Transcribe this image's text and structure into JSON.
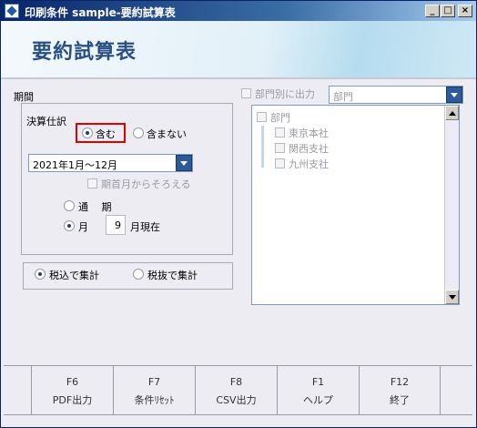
{
  "window": {
    "title": "印刷条件 sample-要約試算表"
  },
  "header": {
    "title": "要約試算表"
  },
  "period": {
    "label": "期間",
    "settlement": {
      "label": "決算仕訳",
      "include": "含む",
      "exclude": "含まない",
      "selected": "include"
    },
    "period_select": {
      "value": "2021年1月～12月"
    },
    "align_checkbox": {
      "label": "期首月からそろえる",
      "checked": false,
      "enabled": false
    },
    "mode": {
      "annual": "通　 期",
      "monthly": "月",
      "month_value": "9",
      "month_suffix": "月現在",
      "selected": "monthly"
    }
  },
  "tax": {
    "include": "税込で集計",
    "exclude": "税抜で集計",
    "selected": "include"
  },
  "department": {
    "by_dept_label": "部門別に出力",
    "by_dept_checked": false,
    "select_value": "部門",
    "tree": {
      "root": "部門",
      "items": [
        "東京本社",
        "関西支社",
        "九州支社"
      ]
    }
  },
  "footer": {
    "keys": [
      {
        "key": "F6",
        "label": "PDF出力"
      },
      {
        "key": "F7",
        "label": "条件ﾘｾｯﾄ"
      },
      {
        "key": "F8",
        "label": "CSV出力"
      },
      {
        "key": "F1",
        "label": "ヘルプ"
      },
      {
        "key": "F12",
        "label": "終了"
      }
    ]
  },
  "colors": {
    "title_bar": "#0a246a",
    "accent": "#2d5b9a",
    "highlight_box": "#e00000"
  }
}
